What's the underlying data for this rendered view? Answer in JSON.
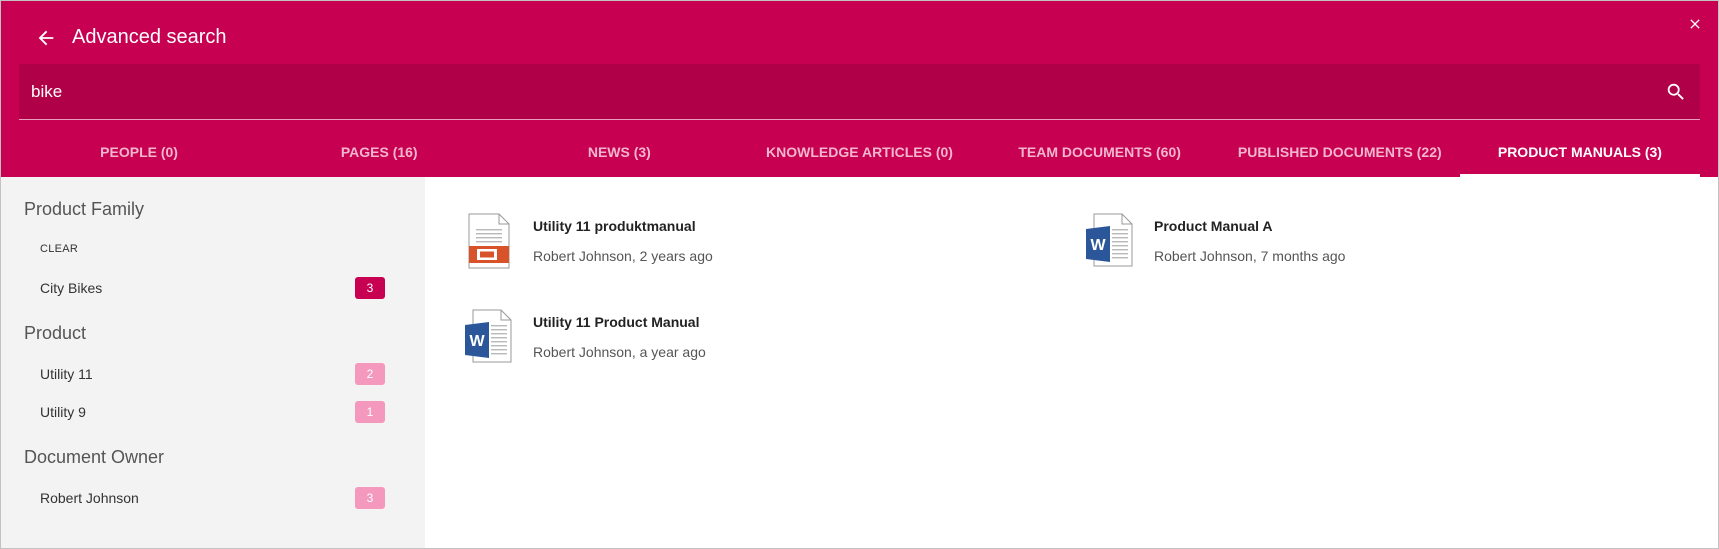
{
  "header": {
    "title": "Advanced search",
    "accent_color": "#c70052"
  },
  "search": {
    "value": "bike",
    "placeholder": ""
  },
  "tabs": [
    {
      "label": "PEOPLE (0)"
    },
    {
      "label": "PAGES (16)"
    },
    {
      "label": "NEWS (3)"
    },
    {
      "label": "KNOWLEDGE ARTICLES (0)"
    },
    {
      "label": "TEAM DOCUMENTS (60)"
    },
    {
      "label": "PUBLISHED DOCUMENTS (22)"
    },
    {
      "label": "PRODUCT MANUALS (3)",
      "active": true
    }
  ],
  "facets": {
    "product_family": {
      "title": "Product Family",
      "clear_label": "CLEAR",
      "items": [
        {
          "label": "City Bikes",
          "count": "3",
          "selected": true
        }
      ]
    },
    "product": {
      "title": "Product",
      "items": [
        {
          "label": "Utility 11",
          "count": "2"
        },
        {
          "label": "Utility 9",
          "count": "1"
        }
      ]
    },
    "document_owner": {
      "title": "Document Owner",
      "items": [
        {
          "label": "Robert Johnson",
          "count": "3"
        }
      ]
    }
  },
  "results": [
    {
      "title": "Utility 11 produktmanual",
      "meta": "Robert Johnson, 2 years ago",
      "icon": "powerpoint-file-icon"
    },
    {
      "title": "Product Manual A",
      "meta": "Robert Johnson, 7 months ago",
      "icon": "word-file-icon"
    },
    {
      "title": "Utility 11 Product Manual",
      "meta": "Robert Johnson, a year ago",
      "icon": "word-file-icon"
    }
  ]
}
